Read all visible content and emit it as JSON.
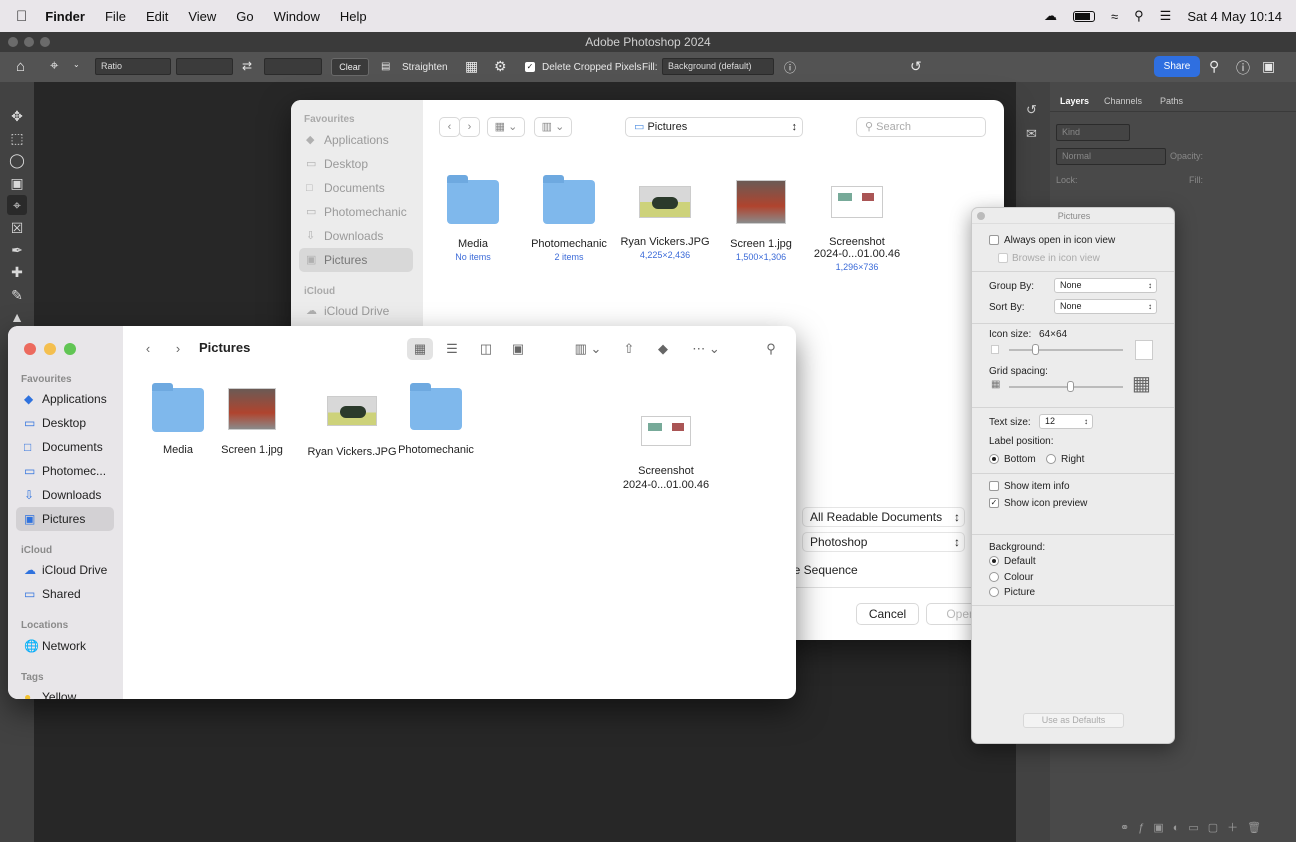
{
  "menubar": {
    "app": "Finder",
    "items": [
      "File",
      "Edit",
      "View",
      "Go",
      "Window",
      "Help"
    ],
    "datetime": "Sat 4 May  10:14"
  },
  "photoshop": {
    "title": "Adobe Photoshop 2024",
    "options": {
      "ratio": "Ratio",
      "clear": "Clear",
      "straighten": "Straighten",
      "delete_cropped": "Delete Cropped Pixels",
      "fill_label": "Fill:",
      "fill_value": "Background (default)",
      "share": "Share"
    },
    "panels": {
      "tabs": [
        "Layers",
        "Channels",
        "Paths"
      ],
      "kind": "Kind",
      "blend": "Normal",
      "opacity": "Opacity:",
      "lock": "Lock:",
      "fill": "Fill:"
    }
  },
  "open_dialog": {
    "sidebar_header": "Favourites",
    "sidebar": [
      "Applications",
      "Desktop",
      "Documents",
      "Photomechanic",
      "Downloads",
      "Pictures"
    ],
    "icloud_header": "iCloud",
    "icloud": [
      "iCloud Drive"
    ],
    "location": "Pictures",
    "search_placeholder": "Search",
    "files": [
      {
        "name": "Media",
        "sub": "No items"
      },
      {
        "name": "Photomechanic",
        "sub": "2 items"
      },
      {
        "name": "Ryan Vickers.JPG",
        "sub": "4,225×2,436"
      },
      {
        "name": "Screen 1.jpg",
        "sub": "1,500×1,306"
      },
      {
        "name": "Screenshot\n2024-0...01.00.46",
        "sub": "1,296×736"
      }
    ],
    "enable": "All Readable Documents",
    "format": "Photoshop",
    "sequence": "ge Sequence",
    "cancel": "Cancel",
    "open": "Open"
  },
  "finder": {
    "title": "Pictures",
    "sections": [
      {
        "header": "Favourites",
        "items": [
          "Applications",
          "Desktop",
          "Documents",
          "Photomec...",
          "Downloads",
          "Pictures"
        ]
      },
      {
        "header": "iCloud",
        "items": [
          "iCloud Drive",
          "Shared"
        ]
      },
      {
        "header": "Locations",
        "items": [
          "Network"
        ]
      },
      {
        "header": "Tags",
        "items": [
          "Yellow"
        ]
      }
    ],
    "files": [
      "Media",
      "Screen 1.jpg",
      "Ryan Vickers.JPG",
      "Photomechanic",
      "Screenshot\n2024-0...01.00.46"
    ]
  },
  "view_options": {
    "title": "Pictures",
    "always_open": "Always open in icon view",
    "browse": "Browse in icon view",
    "group_by_label": "Group By:",
    "group_by": "None",
    "sort_by_label": "Sort By:",
    "sort_by": "None",
    "icon_size_label": "Icon size:",
    "icon_size": "64×64",
    "grid_spacing": "Grid spacing:",
    "text_size_label": "Text size:",
    "text_size": "12",
    "label_position": "Label position:",
    "bottom": "Bottom",
    "right": "Right",
    "show_item_info": "Show item info",
    "show_icon_preview": "Show icon preview",
    "background": "Background:",
    "bg_default": "Default",
    "bg_colour": "Colour",
    "bg_picture": "Picture",
    "use_defaults": "Use as Defaults"
  }
}
